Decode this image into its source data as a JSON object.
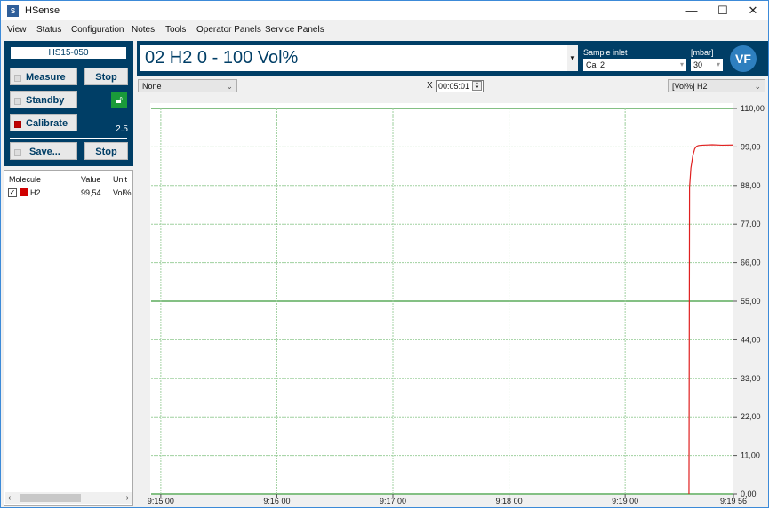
{
  "window": {
    "title": "HSense",
    "app_icon": "S",
    "controls": {
      "minimize": "—",
      "maximize": "☐",
      "close": "✕"
    }
  },
  "menu": [
    "View",
    "Status",
    "Configuration",
    "Notes",
    "Tools",
    "Operator Panels",
    "Service Panels"
  ],
  "control_panel": {
    "device_name": "HS15-050",
    "measure_label": "Measure",
    "stop_label": "Stop",
    "standby_label": "Standby",
    "calibrate_label": "Calibrate",
    "save_label": "Save...",
    "stop2_label": "Stop",
    "version": "2.5",
    "lock_icon": "unlocked-padlock",
    "calibrate_active": true
  },
  "molecule_table": {
    "headers": [
      "Molecule",
      "Value",
      "Unit"
    ],
    "rows": [
      {
        "checked": true,
        "color": "#d00000",
        "molecule": "H2",
        "value": "99,54",
        "unit": "Vol%"
      }
    ]
  },
  "header": {
    "method": "02 H2 0 - 100 Vol%",
    "sample_inlet_label": "Sample inlet",
    "sample_inlet_value": "Cal 2",
    "pressure_label": "[mbar]",
    "pressure_value": "30",
    "logo": "VF"
  },
  "toolbar": {
    "left_select": "None",
    "x_label": "X",
    "time_window": "00:05:01",
    "right_select": "[Vol%] H2"
  },
  "chart_data": {
    "type": "line",
    "title": "",
    "xlabel": "",
    "ylabel": "",
    "x_ticks": [
      "9:15 00",
      "9:16 00",
      "9:17 00",
      "9:18 00",
      "9:19 00",
      "9:19 56"
    ],
    "x_range_seconds": [
      -5,
      296
    ],
    "x_tick_seconds": [
      0,
      60,
      120,
      180,
      240,
      296
    ],
    "y_ticks": [
      "0,00",
      "11,00",
      "22,00",
      "33,00",
      "44,00",
      "55,00",
      "66,00",
      "77,00",
      "88,00",
      "99,00",
      "110,00"
    ],
    "ylim": [
      0,
      110
    ],
    "grid": true,
    "y_axis_position": "right",
    "series": [
      {
        "name": "[Vol%] H2",
        "color": "#e02020",
        "x_seconds": [
          273,
          273.3,
          274,
          275,
          276,
          277,
          278,
          280,
          285,
          290,
          296
        ],
        "y": [
          0,
          87.5,
          93,
          96.5,
          98.5,
          99.2,
          99.4,
          99.5,
          99.6,
          99.5,
          99.55
        ]
      }
    ]
  }
}
